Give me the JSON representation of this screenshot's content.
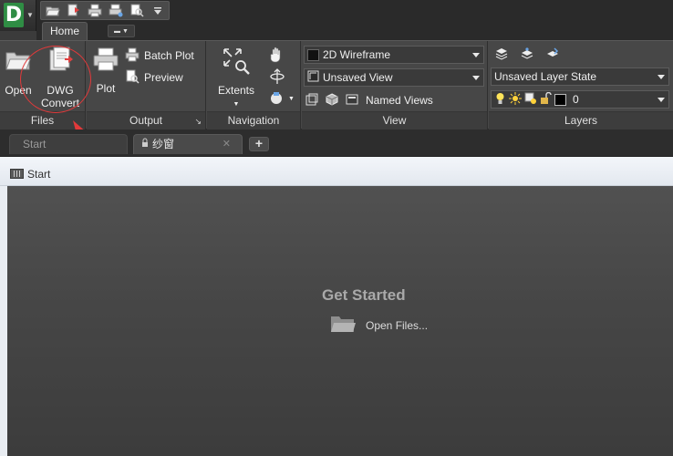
{
  "app": {
    "logo_letter": "D",
    "accent": "#2f8d44",
    "qat_icons": [
      "open-folder-icon",
      "save-file-icon",
      "print-icon",
      "plot-icon",
      "preview-icon",
      "chevron-down-icon"
    ]
  },
  "ribbon": {
    "tabs": [
      {
        "label": "Home",
        "active": true
      }
    ],
    "panels": {
      "files": {
        "title": "Files",
        "buttons": [
          {
            "name": "open",
            "label": "Open",
            "icon": "folder-open-icon"
          },
          {
            "name": "dwg-convert",
            "label": "DWG Convert",
            "icon": "dwg-convert-icon"
          }
        ]
      },
      "output": {
        "title": "Output",
        "plot_label": "Plot",
        "batch_plot_label": "Batch Plot",
        "preview_label": "Preview"
      },
      "navigation": {
        "title": "Navigation",
        "extents_label": "Extents"
      },
      "view": {
        "title": "View",
        "visual_style": "2D Wireframe",
        "saved_view": "Unsaved View",
        "named_views_label": "Named Views"
      },
      "layers": {
        "title": "Layers",
        "layer_state": "Unsaved Layer State",
        "current_layer": "0"
      }
    }
  },
  "annotation": {
    "color": "#e2393a",
    "target": "dwg-convert"
  },
  "document_tabs": [
    {
      "label": "Start",
      "active": false
    },
    {
      "label": "纱窗",
      "active": true,
      "close": "✕"
    }
  ],
  "new_tab_label": "+",
  "start_page": {
    "window_title": "Start",
    "heading": "Get Started",
    "open_files_label": "Open Files..."
  }
}
